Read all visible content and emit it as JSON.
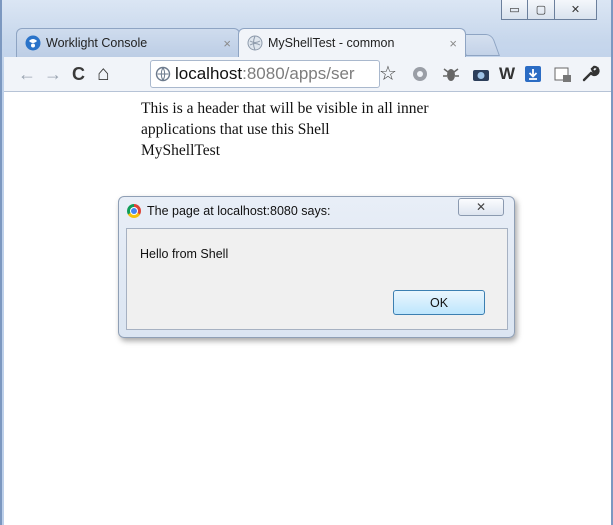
{
  "window": {
    "minimize_glyph": "▭",
    "maximize_glyph": "▢",
    "close_glyph": "✕"
  },
  "tabs": [
    {
      "label": "Worklight Console",
      "close": "×",
      "active": false,
      "icon": "worklight-icon"
    },
    {
      "label": "MyShellTest - common",
      "close": "×",
      "active": true,
      "icon": "globe-icon"
    }
  ],
  "toolbar": {
    "back": "←",
    "forward": "→",
    "reload": "C",
    "home": "⌂",
    "url_host": "localhost",
    "url_rest": ":8080/apps/ser",
    "star": "☆",
    "w_ext": "W"
  },
  "page": {
    "header_text": "This is a header that will be visible in all inner applications that use this Shell",
    "app_name": "MyShellTest"
  },
  "dialog": {
    "title": "The page at localhost:8080 says:",
    "message": "Hello from Shell",
    "ok_label": "OK",
    "close_glyph": "✕"
  },
  "colors": {
    "frame": "#c7d7ec",
    "ok_border": "#3c7fb1"
  }
}
